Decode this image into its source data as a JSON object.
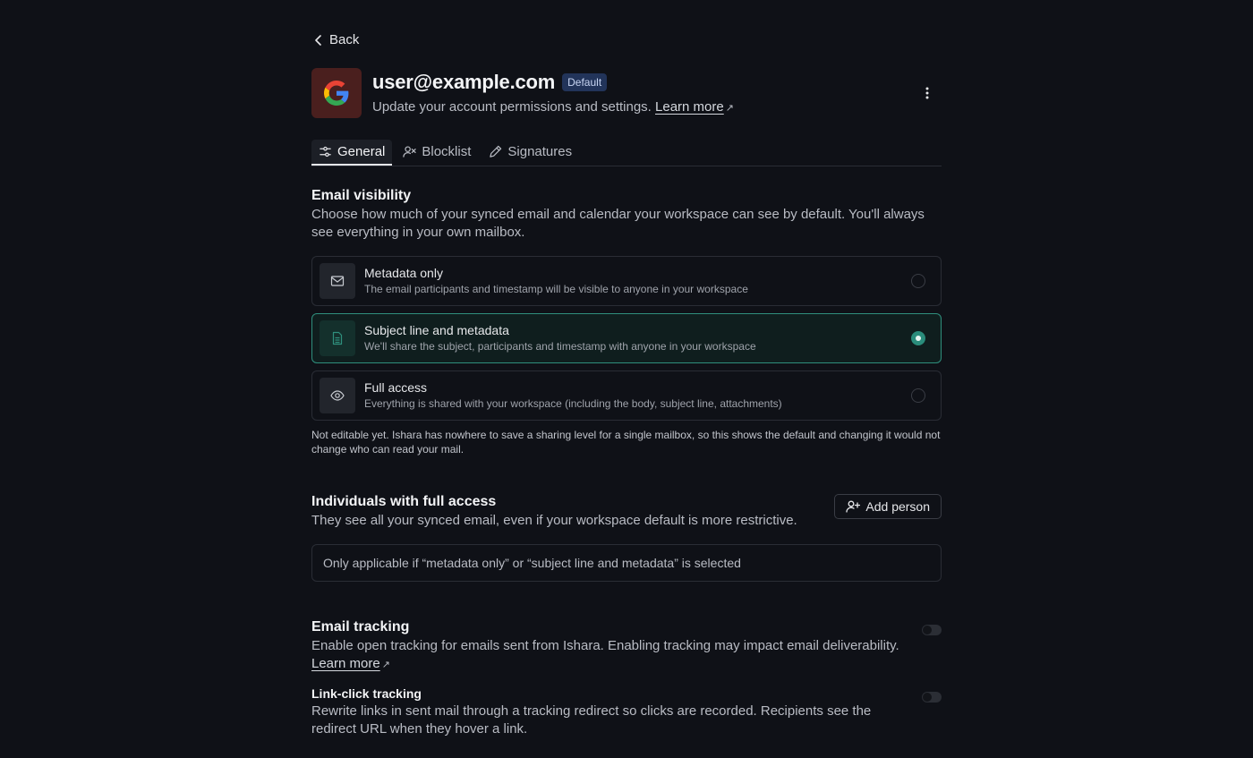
{
  "back": {
    "label": "Back"
  },
  "header": {
    "title": "user@example.com",
    "badge": "Default",
    "subtitle": "Update your account permissions and settings.",
    "learn_more": "Learn more",
    "arrow": "↗"
  },
  "tabs": [
    {
      "label": "General",
      "icon": "sliders-icon",
      "active": true
    },
    {
      "label": "Blocklist",
      "icon": "user-block-icon",
      "active": false
    },
    {
      "label": "Signatures",
      "icon": "pen-icon",
      "active": false
    }
  ],
  "visibility": {
    "title": "Email visibility",
    "description": "Choose how much of your synced email and calendar your workspace can see by default. You'll always see everything in your own mailbox.",
    "options": [
      {
        "label": "Metadata only",
        "description": "The email participants and timestamp will be visible to anyone in your workspace",
        "icon": "mail-icon",
        "selected": false
      },
      {
        "label": "Subject line and metadata",
        "description": "We'll share the subject, participants and timestamp with anyone in your workspace",
        "icon": "document-icon",
        "selected": true
      },
      {
        "label": "Full access",
        "description": "Everything is shared with your workspace (including the body, subject line, attachments)",
        "icon": "eye-icon",
        "selected": false
      }
    ],
    "note": "Not editable yet. Ishara has nowhere to save a sharing level for a single mailbox, so this shows the default and changing it would not change who can read your mail."
  },
  "individuals": {
    "title": "Individuals with full access",
    "description": "They see all your synced email, even if your workspace default is more restrictive.",
    "add_button": "Add person",
    "empty_text": "Only applicable if “metadata only” or “subject line and metadata” is selected"
  },
  "tracking": {
    "title": "Email tracking",
    "description": "Enable open tracking for emails sent from Ishara. Enabling tracking may impact email deliverability.",
    "learn_more": "Learn more",
    "arrow": "↗",
    "enabled": false
  },
  "link_click": {
    "title": "Link-click tracking",
    "description": "Rewrite links in sent mail through a tracking redirect so clicks are recorded. Recipients see the redirect URL when they hover a link.",
    "enabled": false
  },
  "colors": {
    "background": "#0f1117",
    "accent": "#2a8c7b",
    "badge": "#22345a"
  }
}
